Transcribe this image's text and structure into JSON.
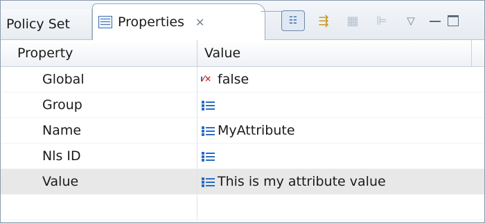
{
  "tabs": {
    "policy_set_label": "Policy Set",
    "properties_label": "Properties",
    "close_glyph": "✕"
  },
  "toolbar": {
    "show_categories_icon": "tree-view-icon",
    "filter_icon": "filter-advanced-icon",
    "restore_default_icon": "restore-default-icon",
    "pin_icon": "pin-icon",
    "view_menu_glyph": "▽"
  },
  "table": {
    "columns": [
      "Property",
      "Value"
    ],
    "rows": [
      {
        "property": "Global",
        "value": "false",
        "icon": "boolean-value-icon"
      },
      {
        "property": "Group",
        "value": "",
        "icon": "text-value-icon"
      },
      {
        "property": "Name",
        "value": "MyAttribute",
        "icon": "text-value-icon"
      },
      {
        "property": "Nls ID",
        "value": "",
        "icon": "text-value-icon"
      },
      {
        "property": "Value",
        "value": "This is my attribute value",
        "icon": "text-value-icon",
        "selected": true
      }
    ]
  },
  "colors": {
    "selected_row": "#e8e8e8",
    "icon_blue": "#2a6bbf",
    "border": "#8a9aac"
  }
}
